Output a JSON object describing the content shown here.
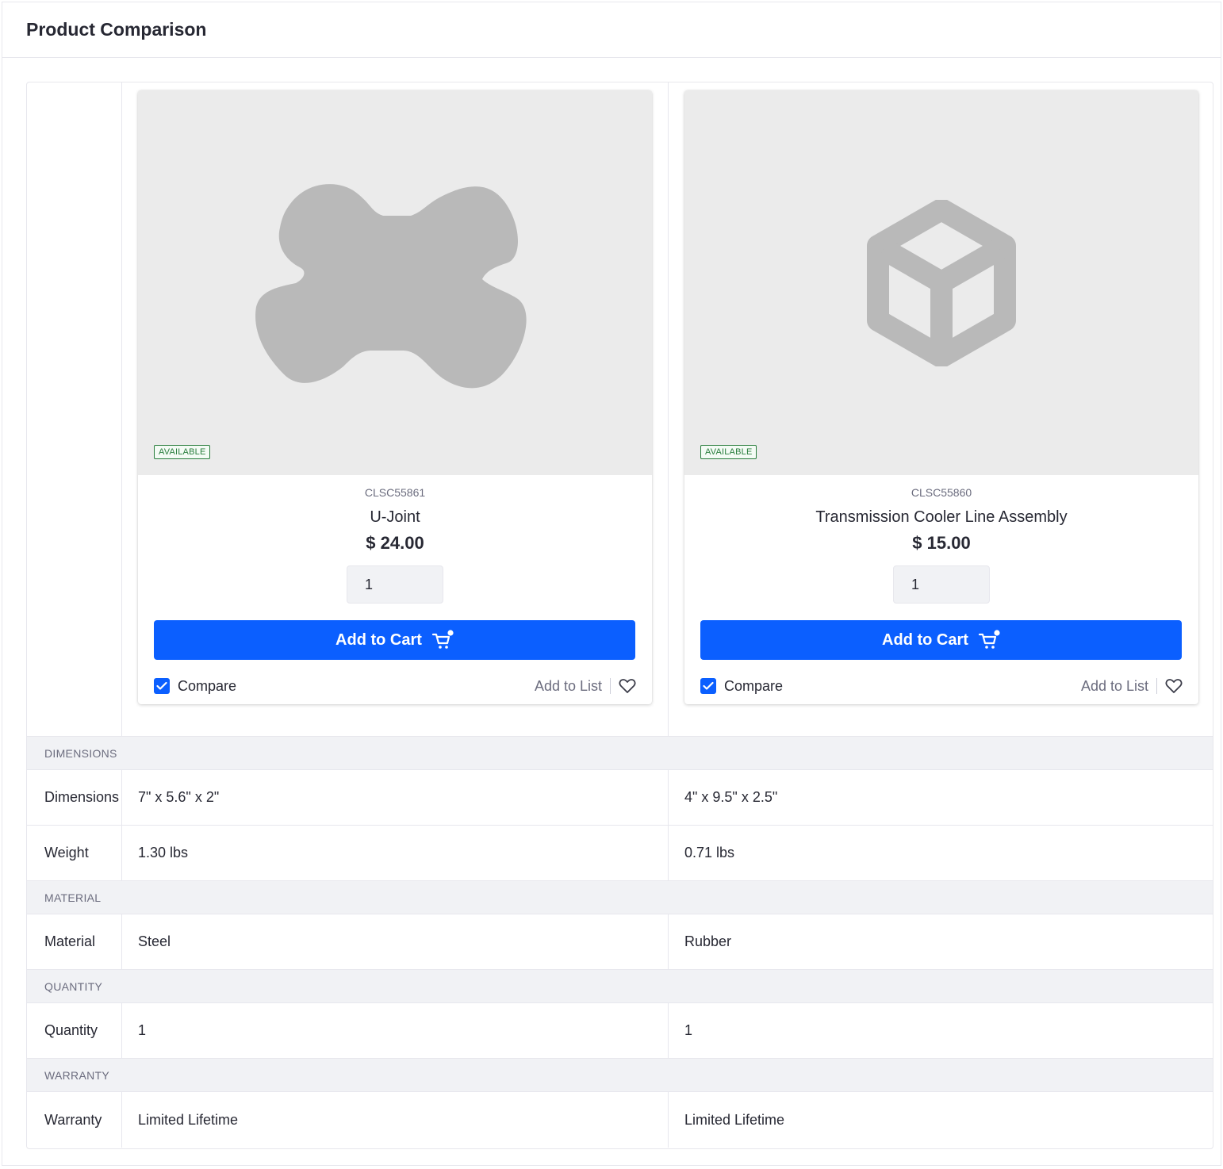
{
  "page": {
    "title": "Product Comparison"
  },
  "products": [
    {
      "sku": "CLSC55861",
      "name": "U-Joint",
      "price": "$ 24.00",
      "quantity": "1",
      "availability": "AVAILABLE",
      "add_to_cart_label": "Add to Cart",
      "compare_label": "Compare",
      "compare_checked": true,
      "add_to_list_label": "Add to List",
      "image_icon": "u-joint-image"
    },
    {
      "sku": "CLSC55860",
      "name": "Transmission Cooler Line Assembly",
      "price": "$ 15.00",
      "quantity": "1",
      "availability": "AVAILABLE",
      "add_to_cart_label": "Add to Cart",
      "compare_label": "Compare",
      "compare_checked": true,
      "add_to_list_label": "Add to List",
      "image_icon": "cube-icon"
    }
  ],
  "sections": [
    {
      "title": "DIMENSIONS",
      "rows": [
        {
          "label": "Dimensions",
          "values": [
            "7\" x 5.6\" x 2\"",
            "4\" x 9.5\" x 2.5\""
          ]
        },
        {
          "label": "Weight",
          "values": [
            "1.30 lbs",
            "0.71 lbs"
          ]
        }
      ]
    },
    {
      "title": "MATERIAL",
      "rows": [
        {
          "label": "Material",
          "values": [
            "Steel",
            "Rubber"
          ]
        }
      ]
    },
    {
      "title": "QUANTITY",
      "rows": [
        {
          "label": "Quantity",
          "values": [
            "1",
            "1"
          ]
        }
      ]
    },
    {
      "title": "WARRANTY",
      "rows": [
        {
          "label": "Warranty",
          "values": [
            "Limited Lifetime",
            "Limited Lifetime"
          ]
        }
      ]
    }
  ],
  "colors": {
    "primary": "#0b5fff",
    "available": "#287d3c",
    "section_bg": "#f1f2f5",
    "image_bg": "#ebebeb",
    "placeholder_gray": "#b9b9b9"
  }
}
